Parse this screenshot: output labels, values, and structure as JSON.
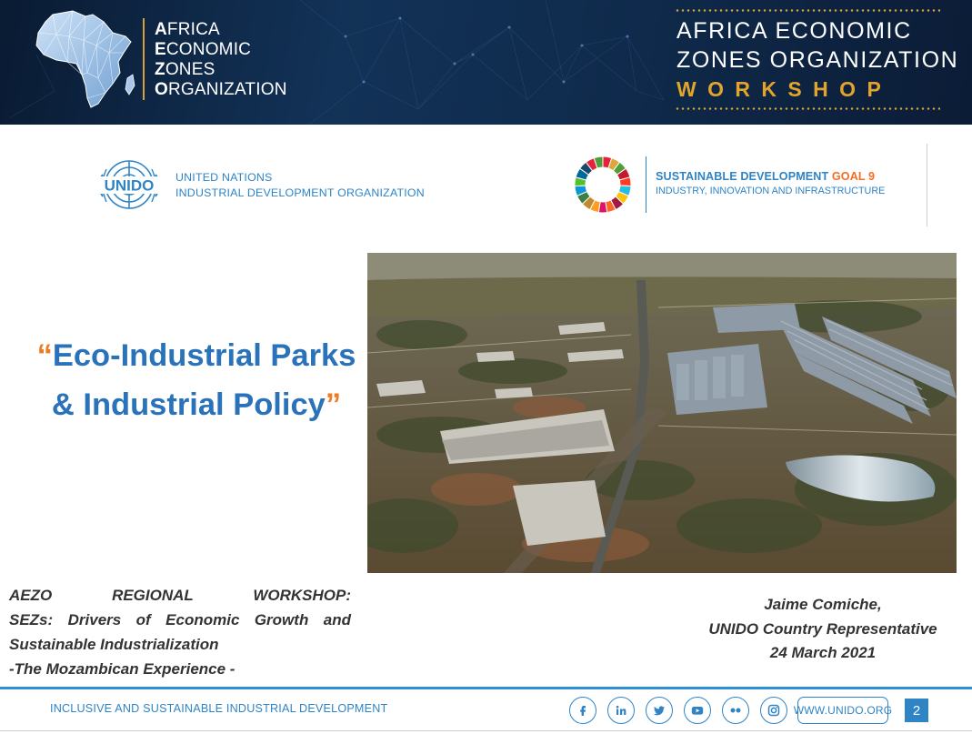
{
  "banner": {
    "org_lines": [
      {
        "initial": "A",
        "rest": "FRICA"
      },
      {
        "initial": "E",
        "rest": "CONOMIC"
      },
      {
        "initial": "Z",
        "rest": "ONES"
      },
      {
        "initial": "O",
        "rest": "RGANIZATION"
      }
    ],
    "workshop_line1": "AFRICA ECONOMIC",
    "workshop_line2": "ZONES ORGANIZATION",
    "workshop_line3": "WORKSHOP"
  },
  "partners": {
    "unido_acronym": "UNIDO",
    "unido_line1": "UNITED NATIONS",
    "unido_line2": "INDUSTRIAL DEVELOPMENT ORGANIZATION",
    "sdg_title": "SUSTAINABLE DEVELOPMENT",
    "sdg_goal": "GOAL 9",
    "sdg_subtitle": "INDUSTRY, INNOVATION AND INFRASTRUCTURE"
  },
  "slide": {
    "open_quote": "“",
    "title_line1": "Eco-Industrial Parks",
    "title_line2": "& Industrial Policy",
    "close_quote": "”"
  },
  "workshop_info": {
    "line1": "AEZO REGIONAL WORKSHOP:",
    "line2": "SEZs: Drivers of Economic Growth and",
    "line3": "Sustainable Industrialization",
    "line4": "-The Mozambican Experience -"
  },
  "presenter": {
    "name": "Jaime Comiche,",
    "role": "UNIDO Country Representative",
    "date": "24 March 2021"
  },
  "footer": {
    "tagline": "INCLUSIVE AND SUSTAINABLE INDUSTRIAL DEVELOPMENT",
    "social_icons": [
      "facebook-icon",
      "linkedin-icon",
      "twitter-icon",
      "youtube-icon",
      "flickr-icon",
      "instagram-icon"
    ],
    "website": "WWW.UNIDO.ORG",
    "page_number": "2"
  },
  "colors": {
    "banner_bg": "#0f2a4b",
    "gold": "#e3a42c",
    "unido_blue": "#2f84c5",
    "title_blue": "#2a72b9",
    "quote_orange": "#ee7a23",
    "goal_orange": "#f36d25"
  }
}
